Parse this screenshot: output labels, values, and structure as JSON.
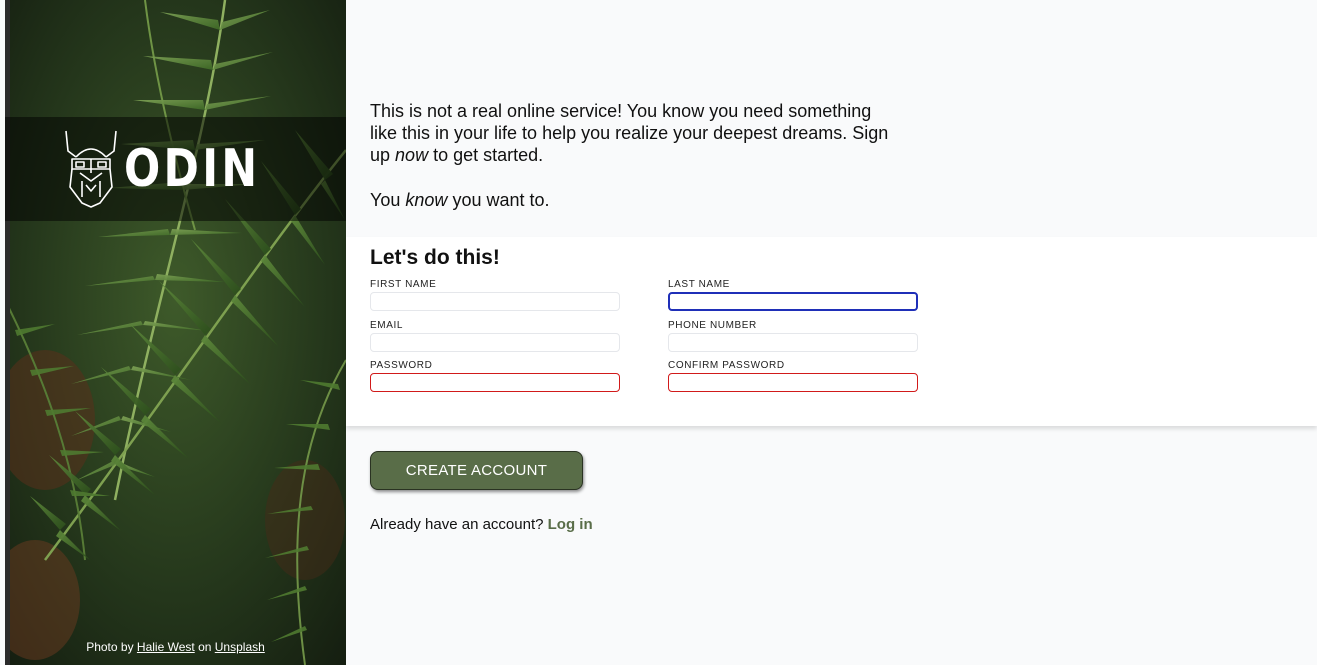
{
  "hero": {
    "logo_text": "ODIN",
    "logo_icon": "viking-helmet-icon",
    "credit": {
      "prefix": "Photo by",
      "author": "Halie West",
      "middle": "on",
      "site": "Unsplash"
    }
  },
  "intro": {
    "line_start": "This is not a real online service! You know you need something like this in your life to help you realize your deepest dreams. Sign up",
    "line_emph": "now",
    "line_end": "to get started.",
    "know_start": "You",
    "know_emph": "know",
    "know_end": "you want to."
  },
  "form": {
    "title": "Let's do this!",
    "fields": {
      "first_name": {
        "label": "FIRST NAME",
        "value": ""
      },
      "last_name": {
        "label": "LAST NAME",
        "value": ""
      },
      "email": {
        "label": "EMAIL",
        "value": ""
      },
      "phone": {
        "label": "PHONE NUMBER",
        "value": ""
      },
      "password": {
        "label": "PASSWORD",
        "value": ""
      },
      "confirm_password": {
        "label": "CONFIRM PASSWORD",
        "value": ""
      }
    }
  },
  "actions": {
    "create_label": "CREATE ACCOUNT",
    "login_prompt": "Already have an account?",
    "login_link": "Log in"
  },
  "colors": {
    "accent": "#596d48",
    "invalid": "#d11a1a",
    "focus": "#1f2fb8",
    "page_bg": "#f9fafb"
  }
}
